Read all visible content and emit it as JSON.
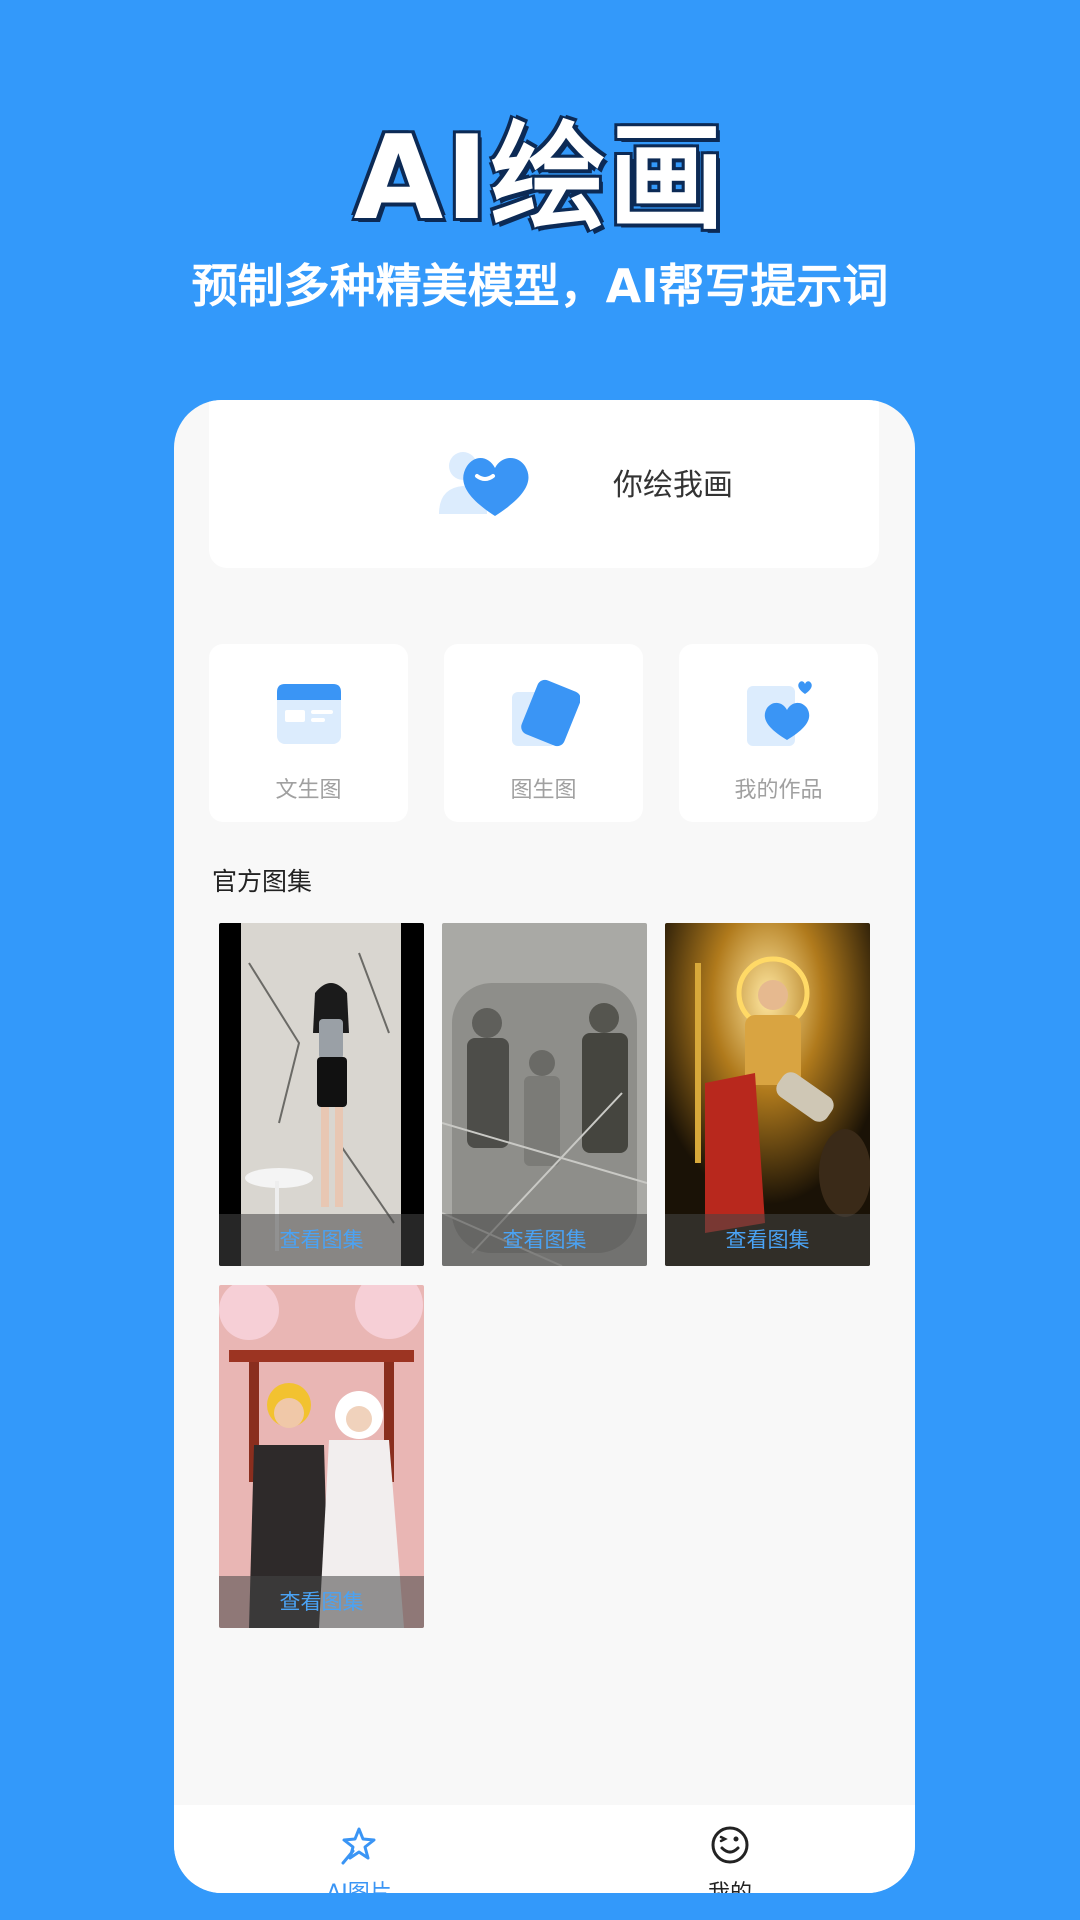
{
  "hero": {
    "title": "AI绘画",
    "subtitle": "预制多种精美模型，AI帮写提示词"
  },
  "banner": {
    "label": "你绘我画",
    "icon": "heart-user-icon"
  },
  "features": [
    {
      "label": "文生图",
      "icon": "text-card-icon"
    },
    {
      "label": "图生图",
      "icon": "image-cards-icon"
    },
    {
      "label": "我的作品",
      "icon": "heart-card-icon"
    }
  ],
  "gallery": {
    "title": "官方图集",
    "items": [
      {
        "action": "查看图集"
      },
      {
        "action": "查看图集"
      },
      {
        "action": "查看图集"
      },
      {
        "action": "查看图集"
      }
    ]
  },
  "tabbar": {
    "items": [
      {
        "label": "AI图片",
        "icon": "magic-star-icon",
        "active": true
      },
      {
        "label": "我的",
        "icon": "smiley-face-icon",
        "active": false
      }
    ]
  },
  "colors": {
    "background": "#3399fa",
    "accent": "#4aa3f5",
    "panel": "#f8f8f8"
  }
}
